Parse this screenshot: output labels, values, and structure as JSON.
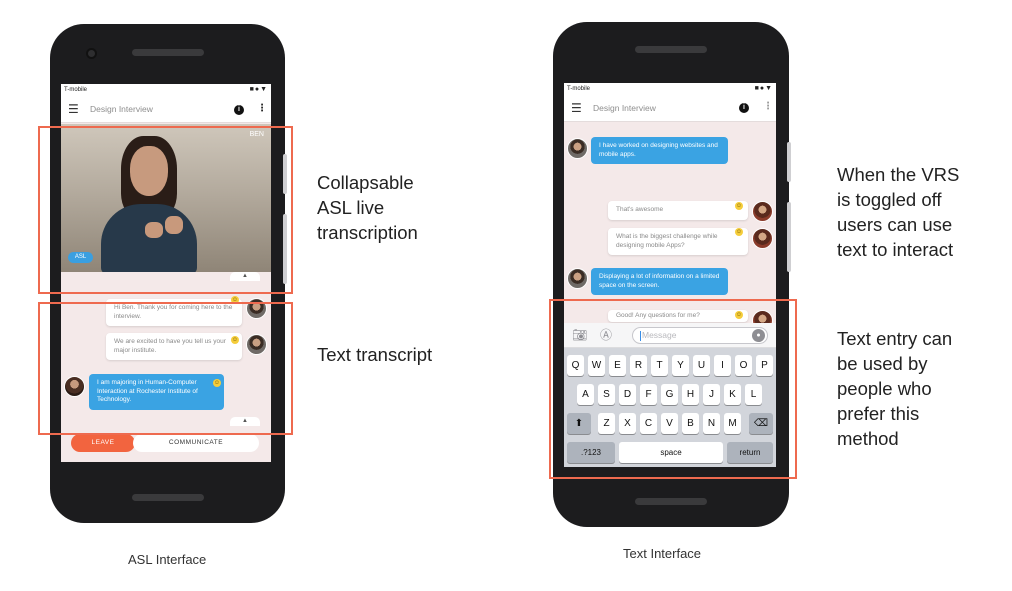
{
  "left_phone": {
    "status_carrier": "T-mobile",
    "status_icons": "■●▼",
    "title": "Design Interview",
    "menu_icon": "hamburger-icon",
    "info_icon": "info-icon",
    "more_icon": "more-vert-icon",
    "video": {
      "name": "BEN",
      "asl_label": "ASL",
      "collapse": "▲"
    },
    "messages": [
      {
        "type": "incoming",
        "text": "Hi Ben. Thank you for coming here to the interview."
      },
      {
        "type": "incoming",
        "text": "We are excited to have you tell us your major institute."
      },
      {
        "type": "outgoing",
        "text": "I am majoring in Human-Computer Interaction at Rochester Institute of Technology."
      }
    ],
    "expand": "▲",
    "leave_label": "LEAVE",
    "communicate_label": "COMMUNICATE"
  },
  "right_phone": {
    "status_carrier": "T-mobile",
    "status_icons": "■●▼",
    "title": "Design Interview",
    "messages": [
      {
        "type": "outgoing",
        "text": "I have worked on designing websites and mobile apps."
      },
      {
        "type": "incoming",
        "text": "That's awesome"
      },
      {
        "type": "incoming",
        "text": "What is the biggest challenge while designing mobile Apps?"
      },
      {
        "type": "outgoing",
        "text": "Displaying a lot of information on a limited space on the screen."
      },
      {
        "type": "incoming",
        "text": "Good! Any questions for me?"
      }
    ],
    "input_placeholder": "Message",
    "keyboard": {
      "row1": [
        "Q",
        "W",
        "E",
        "R",
        "T",
        "Y",
        "U",
        "I",
        "O",
        "P"
      ],
      "row2": [
        "A",
        "S",
        "D",
        "F",
        "G",
        "H",
        "J",
        "K",
        "L"
      ],
      "row3": [
        "Z",
        "X",
        "C",
        "V",
        "B",
        "N",
        "M"
      ],
      "shift": "⬆",
      "backspace": "⌫",
      "numbers": ".?123",
      "space": "space",
      "return": "return"
    }
  },
  "annotations": {
    "asl": [
      "Collapsable",
      "ASL live",
      "transcription"
    ],
    "text_transcript": [
      "Text transcript"
    ],
    "vrs": [
      "When the VRS",
      "is toggled off",
      "users can use",
      "text to interact"
    ],
    "text_entry": [
      "Text entry can",
      "be used by",
      "people who",
      "prefer this",
      "method"
    ]
  },
  "captions": {
    "left": "ASL Interface",
    "right": "Text Interface"
  },
  "colors": {
    "highlight": "#ee6a4f",
    "bubble_blue": "#3aa3e3",
    "leave": "#f2643f",
    "chat_bg": "#f4e9e9"
  }
}
